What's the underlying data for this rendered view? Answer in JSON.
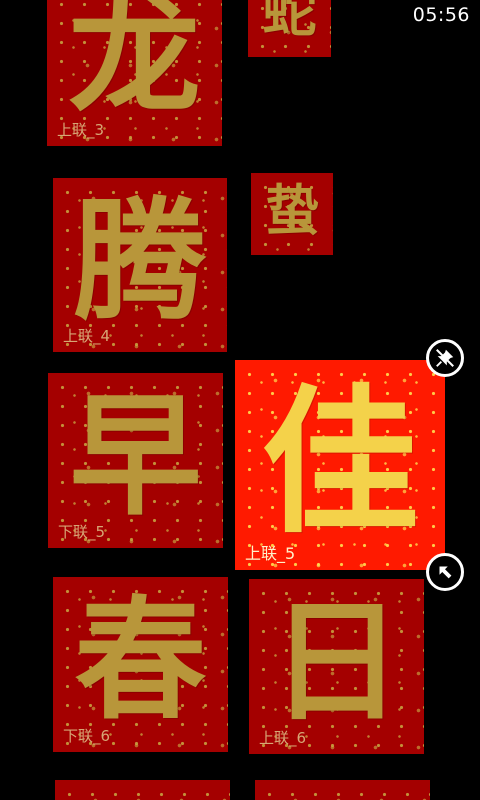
{
  "status_bar": {
    "time": "05:56"
  },
  "tiles": [
    {
      "glyph": "龙",
      "label": "上联_3"
    },
    {
      "glyph": "蛇",
      "label": ""
    },
    {
      "glyph": "腾",
      "label": "上联_4"
    },
    {
      "glyph": "蛰",
      "label": ""
    },
    {
      "glyph": "早",
      "label": "下联_5"
    },
    {
      "glyph": "佳",
      "label": "上联_5"
    },
    {
      "glyph": "春",
      "label": "下联_6"
    },
    {
      "glyph": "日",
      "label": "上联_6"
    }
  ],
  "buttons": {
    "unpin_icon": "unpin-icon",
    "resize_icon": "resize-arrow-icon"
  },
  "colors": {
    "tile_red": "#a40000",
    "tile_active_red": "#ff1a00",
    "gold": "#b8963a"
  }
}
